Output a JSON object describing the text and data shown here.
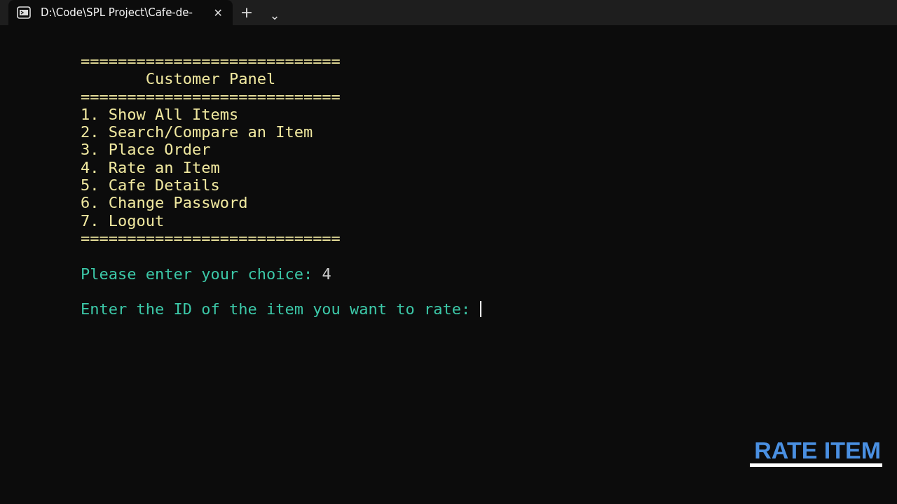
{
  "tabs": [
    {
      "title": "D:\\Code\\SPL Project\\Cafe-de-",
      "close": "✕",
      "selected": true
    }
  ],
  "tab_bar": {
    "new_tab": "+",
    "dropdown": "⌄"
  },
  "terminal": {
    "lines": [
      {
        "kind": "banner",
        "text": "============================"
      },
      {
        "kind": "heading",
        "text": "       Customer Panel"
      },
      {
        "kind": "banner",
        "text": "============================"
      },
      {
        "kind": "menu",
        "text": "1. Show All Items"
      },
      {
        "kind": "menu",
        "text": "2. Search/Compare an Item"
      },
      {
        "kind": "menu",
        "text": "3. Place Order"
      },
      {
        "kind": "menu",
        "text": "4. Rate an Item"
      },
      {
        "kind": "menu",
        "text": "5. Cafe Details"
      },
      {
        "kind": "menu",
        "text": "6. Change Password"
      },
      {
        "kind": "menu",
        "text": "7. Logout"
      },
      {
        "kind": "banner",
        "text": "============================"
      },
      {
        "kind": "blank"
      },
      {
        "kind": "prompt",
        "text": "Please enter your choice: ",
        "input": "4"
      },
      {
        "kind": "blank"
      },
      {
        "kind": "prompt",
        "text": "Enter the ID of the item you want to rate: ",
        "cursor": true
      }
    ]
  },
  "caption": "RATE ITEM"
}
